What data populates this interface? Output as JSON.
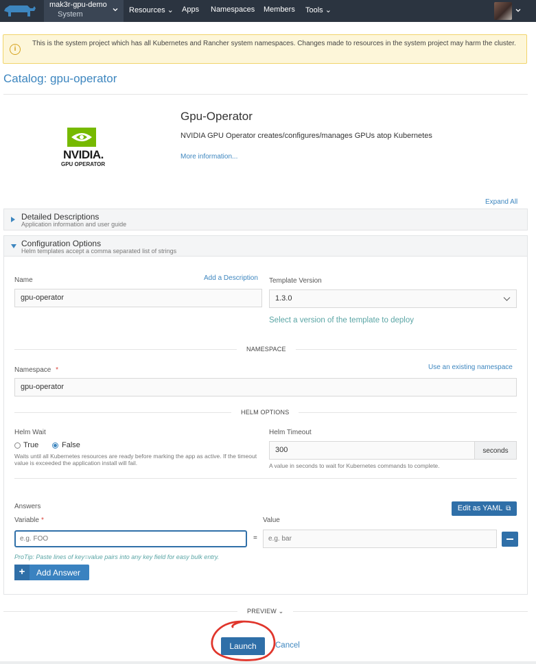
{
  "nav": {
    "cluster_name": "mak3r-gpu-demo",
    "project_name": "System",
    "items": [
      "Resources",
      "Apps",
      "Namespaces",
      "Members",
      "Tools"
    ]
  },
  "banner": {
    "text": "This is the system project which has all Kubernetes and Rancher system namespaces. Changes made to resources in the system project may harm the cluster."
  },
  "page": {
    "title": "Catalog: gpu-operator"
  },
  "app": {
    "logo_word": "NVIDIA.",
    "logo_sub": "GPU OPERATOR",
    "title": "Gpu-Operator",
    "description": "NVIDIA GPU Operator creates/configures/manages GPUs atop Kubernetes",
    "more_info": "More information..."
  },
  "expand_all": "Expand All",
  "sections": {
    "detailed": {
      "title": "Detailed Descriptions",
      "subtitle": "Application information and user guide"
    },
    "config": {
      "title": "Configuration Options",
      "subtitle": "Helm templates accept a comma separated list of strings"
    }
  },
  "form": {
    "name_label": "Name",
    "add_description": "Add a Description",
    "name_value": "gpu-operator",
    "template_version_label": "Template Version",
    "template_version_value": "1.3.0",
    "template_help": "Select a version of the template to deploy",
    "namespace_header": "NAMESPACE",
    "namespace_label": "Namespace",
    "required_mark": "*",
    "use_existing": "Use an existing namespace",
    "namespace_value": "gpu-operator",
    "helm_header": "HELM OPTIONS",
    "helm_wait_label": "Helm Wait",
    "true_label": "True",
    "false_label": "False",
    "helm_wait_help": "Waits until all Kubernetes resources are ready before marking the app as active. If the timeout value is exceeded the application install will fail.",
    "helm_timeout_label": "Helm Timeout",
    "helm_timeout_value": "300",
    "seconds_label": "seconds",
    "helm_timeout_help": "A value in seconds to wait for Kubernetes commands to complete.",
    "answers_label": "Answers",
    "edit_yaml": "Edit as YAML",
    "variable_label": "Variable",
    "value_label": "Value",
    "variable_placeholder": "e.g. FOO",
    "equals": "=",
    "value_placeholder": "e.g. bar",
    "protip": "ProTip: Paste lines of key=value pairs into any key field for easy bulk entry.",
    "add_answer": "Add Answer"
  },
  "footer": {
    "preview": "PREVIEW",
    "launch": "Launch",
    "cancel": "Cancel"
  },
  "colors": {
    "accent": "#3d86bf",
    "primary_button": "#2f6fa8",
    "nav_bg": "#2b3440",
    "annotation": "#e0362c"
  }
}
